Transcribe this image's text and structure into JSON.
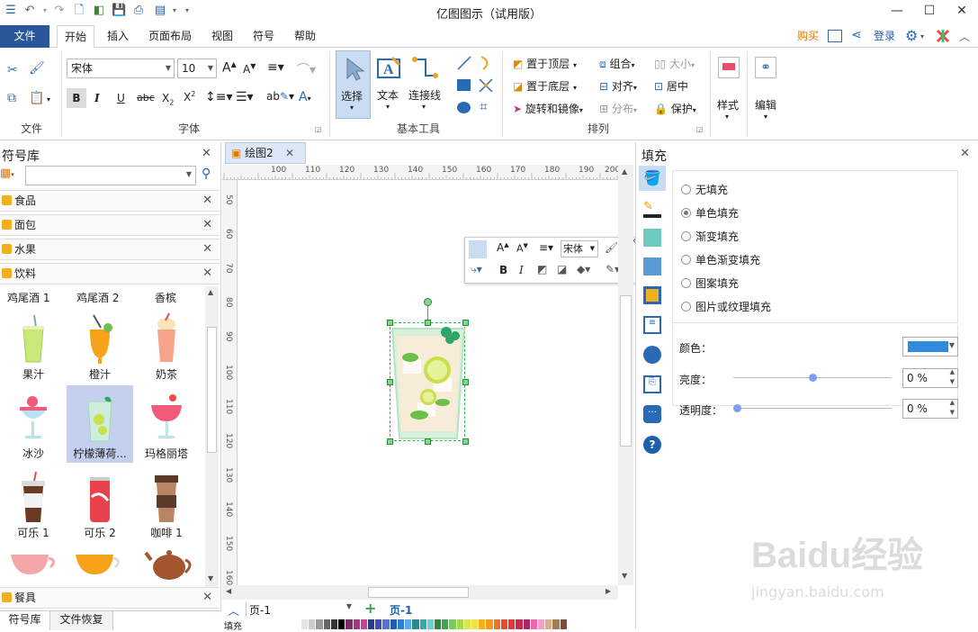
{
  "app": {
    "title": "亿图图示（试用版）"
  },
  "menu": {
    "file": "文件",
    "tabs": [
      "开始",
      "插入",
      "页面布局",
      "视图",
      "符号",
      "帮助"
    ],
    "buy": "购买",
    "login": "登录"
  },
  "ribbon": {
    "groups": {
      "file": "文件",
      "font": "字体",
      "basic_tools": "基本工具",
      "arrange": "排列"
    },
    "font_name": "宋体",
    "font_size": "10",
    "select": "选择",
    "text": "文本",
    "connector": "连接线",
    "bring_front": "置于顶层",
    "send_back": "置于底层",
    "rotate_mirror": "旋转和镜像",
    "group": "组合",
    "align": "对齐",
    "distribute": "分布",
    "size": "大小",
    "center": "居中",
    "protect": "保护",
    "style": "样式",
    "edit": "编辑"
  },
  "library": {
    "title": "符号库",
    "search_value": "",
    "categories": [
      "食品",
      "面包",
      "水果",
      "饮料"
    ],
    "symbols": [
      {
        "label": "鸡尾酒 1",
        "icon": "cocktail-1-icon"
      },
      {
        "label": "鸡尾酒 2",
        "icon": "cocktail-2-icon"
      },
      {
        "label": "香槟",
        "icon": "champagne-icon"
      },
      {
        "label": "果汁",
        "icon": "juice-icon"
      },
      {
        "label": "橙汁",
        "icon": "orange-juice-icon"
      },
      {
        "label": "奶茶",
        "icon": "milk-tea-icon"
      },
      {
        "label": "冰沙",
        "icon": "smoothie-icon"
      },
      {
        "label": "柠檬薄荷...",
        "icon": "lemon-mint-icon"
      },
      {
        "label": "玛格丽塔",
        "icon": "margarita-icon"
      },
      {
        "label": "可乐 1",
        "icon": "cola-1-icon"
      },
      {
        "label": "可乐 2",
        "icon": "cola-2-icon"
      },
      {
        "label": "咖啡 1",
        "icon": "coffee-1-icon"
      }
    ],
    "bottom_category": "餐具",
    "bottom_tabs": [
      "符号库",
      "文件恢复"
    ]
  },
  "document": {
    "tab": "绘图2",
    "ruler_top": [
      "100",
      "110",
      "120",
      "130",
      "140",
      "150",
      "160",
      "170",
      "180",
      "190",
      "200"
    ],
    "ruler_left": [
      "50",
      "60",
      "70",
      "80",
      "90",
      "100",
      "110",
      "120",
      "130",
      "140",
      "150",
      "160"
    ],
    "floating_font": "宋体",
    "page_select": "页-1",
    "page_tab": "页-1",
    "fill_label": "填充"
  },
  "fill_panel": {
    "title": "填充",
    "options": [
      "无填充",
      "单色填充",
      "渐变填充",
      "单色渐变填充",
      "图案填充",
      "图片或纹理填充"
    ],
    "selected_index": 1,
    "color_label": "颜色：",
    "brightness_label": "亮度：",
    "brightness_value": "0 %",
    "transparency_label": "透明度：",
    "transparency_value": "0 %",
    "color_value": "#2f8ae0"
  },
  "watermark": {
    "brand": "Baidu经验",
    "url": "jingyan.baidu.com"
  }
}
